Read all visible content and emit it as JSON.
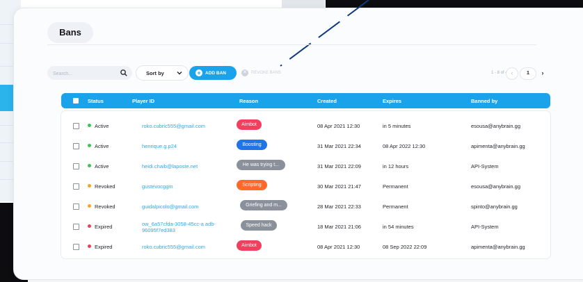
{
  "page": {
    "title": "Bans"
  },
  "toolbar": {
    "search_placeholder": "Search...",
    "sort_label": "Sort by",
    "add_label": "ADD BAN",
    "revoke_label": "REVOKE BANS",
    "pagination_text": "1 - 8 of 424",
    "current_page": "1",
    "prev_symbol": "‹",
    "next_symbol": "›",
    "add_symbol": "+",
    "revoke_symbol": "✕"
  },
  "table": {
    "headers": [
      "Status",
      "Player ID",
      "Reason",
      "Created",
      "Expires",
      "Banned by"
    ],
    "rows": [
      {
        "status": "Active",
        "status_color": "#3fc25a",
        "player": "roko.cubric555@gmail.com",
        "reason": "Aimbot",
        "reason_color": "#f0405e",
        "created": "08 Apr 2021 12:30",
        "expires": "in 5 minutes",
        "banned_by": "esousa@anybrain.gg"
      },
      {
        "status": "Active",
        "status_color": "#3fc25a",
        "player": "henrique.g.p24",
        "reason": "Boosting",
        "reason_color": "#1f74e8",
        "created": "31 Mar 2021 22:34",
        "expires": "08 Apr 2022 12:30",
        "banned_by": "apimenta@anybrain.gg"
      },
      {
        "status": "Active",
        "status_color": "#3fc25a",
        "player": "heidi.chaib@laposte.net",
        "reason": "He was trying t...",
        "reason_color": "#8b919a",
        "created": "31 Mar 2021 22:09",
        "expires": "in 12 hours",
        "banned_by": "API-System"
      },
      {
        "status": "Revoked",
        "status_color": "#f5a623",
        "player": "gustevocggm",
        "reason": "Scripting",
        "reason_color": "#ff6a2b",
        "created": "30 Mar 2021 21:47",
        "expires": "Permanent",
        "banned_by": "esousa@anybrain.gg"
      },
      {
        "status": "Revoked",
        "status_color": "#f5a623",
        "player": "guidalpicolo@gmail.com",
        "reason": "Griefing and m...",
        "reason_color": "#8b919a",
        "created": "28 Mar 2021 22:33",
        "expires": "Permanent",
        "banned_by": "spinto@anybrain.gg"
      },
      {
        "status": "Expired",
        "status_color": "#ef4057",
        "player": "ow_6a57cfda-3058-45cc-a adb-96095f7ed383",
        "reason": "Speed hack",
        "reason_color": "#8b919a",
        "created": "18 Mar 2021 21:06",
        "expires": "in 54 minutes",
        "banned_by": "API-System"
      },
      {
        "status": "Expired",
        "status_color": "#ef4057",
        "player": "roko.cubric555@gmail.com",
        "reason": "Aimbot",
        "reason_color": "#f0405e",
        "created": "08 Apr 2021 12:30",
        "expires": "08 Sep 2022 22:09",
        "banned_by": "apimenta@anybrain.gg"
      }
    ]
  },
  "icons": {
    "search": "search-icon",
    "sort": "chevron-down-icon",
    "add": "plus-circle-icon",
    "revoke": "close-circle-icon"
  },
  "colors": {
    "accent": "#1aa3eb"
  }
}
